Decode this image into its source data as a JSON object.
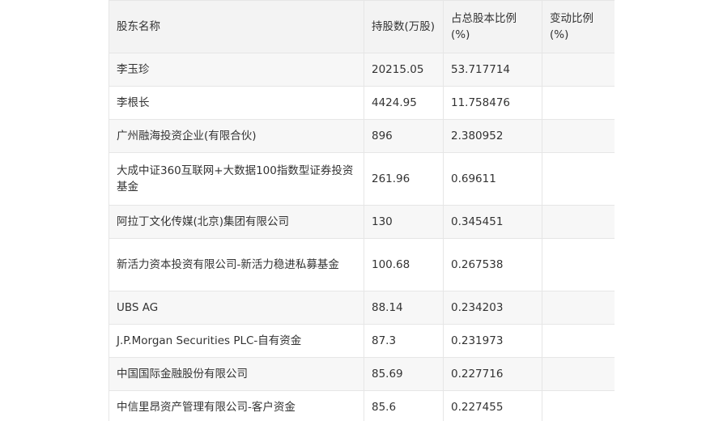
{
  "table": {
    "headers": [
      "股东名称",
      "持股数(万股)",
      "占总股本比例(%)",
      "变动比例(%)"
    ],
    "rows": [
      [
        "李玉珍",
        "20215.05",
        "53.717714",
        ""
      ],
      [
        "李根长",
        "4424.95",
        "11.758476",
        ""
      ],
      [
        "广州融海投资企业(有限合伙)",
        "896",
        "2.380952",
        ""
      ],
      [
        "大成中证360互联网+大数据100指数型证券投资基金",
        "261.96",
        "0.69611",
        ""
      ],
      [
        "阿拉丁文化传媒(北京)集团有限公司",
        "130",
        "0.345451",
        ""
      ],
      [
        "新活力资本投资有限公司-新活力稳进私募基金",
        "100.68",
        "0.267538",
        ""
      ],
      [
        "UBS AG",
        "88.14",
        "0.234203",
        ""
      ],
      [
        "J.P.Morgan Securities PLC-自有资金",
        "87.3",
        "0.231973",
        ""
      ],
      [
        "中国国际金融股份有限公司",
        "85.69",
        "0.227716",
        ""
      ],
      [
        "中信里昂资产管理有限公司-客户资金",
        "85.6",
        "0.227455",
        ""
      ]
    ]
  }
}
